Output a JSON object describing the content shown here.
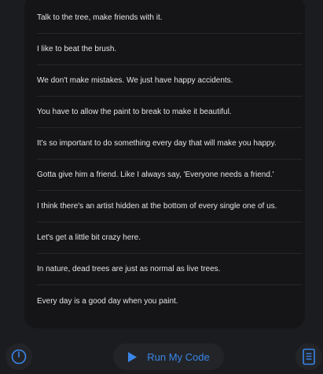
{
  "list": {
    "items": [
      {
        "label": "Talk to the tree, make friends with it."
      },
      {
        "label": "I like to beat the brush."
      },
      {
        "label": "We don't make mistakes. We just have happy accidents."
      },
      {
        "label": "You have to allow the paint to break to make it beautiful."
      },
      {
        "label": "It's so important to do something every day that will make you happy."
      },
      {
        "label": "Gotta give him a friend. Like I always say, 'Everyone needs a friend.'"
      },
      {
        "label": "I think there's an artist hidden at the bottom of every single one of us."
      },
      {
        "label": "Let's get a little bit crazy here."
      },
      {
        "label": "In nature, dead trees are just as normal as live trees."
      },
      {
        "label": "Every day is a good day when you paint."
      }
    ]
  },
  "toolbar": {
    "run_label": "Run My Code",
    "timer_icon": "timer-icon",
    "play_icon": "play-icon",
    "doc_icon": "document-icon"
  },
  "colors": {
    "accent": "#3a86e8",
    "background": "#1b1c1f",
    "panel": "#151518"
  }
}
